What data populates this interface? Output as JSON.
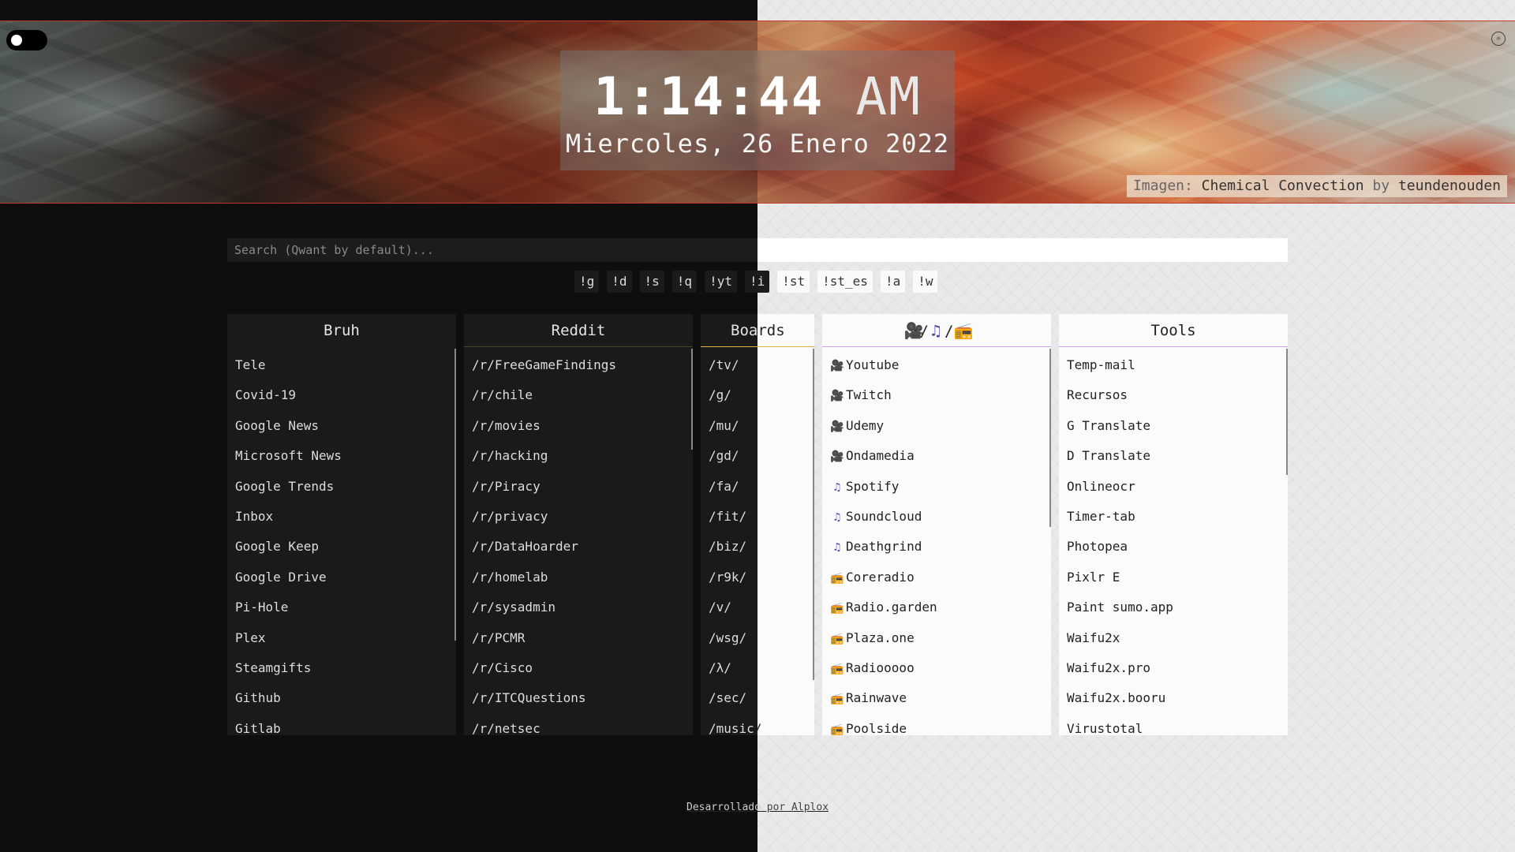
{
  "clock": {
    "time": "1:14:44",
    "ampm": "AM",
    "date": "Miercoles, 26 Enero 2022"
  },
  "credit": {
    "prefix": "Imagen:",
    "title": "Chemical Convection",
    "by": "by",
    "author": "teundenouden"
  },
  "search": {
    "placeholder": "Search (Qwant by default)..."
  },
  "bangs": [
    "!g",
    "!d",
    "!s",
    "!q",
    "!yt",
    "!i",
    "!st",
    "!st_es",
    "!a",
    "!w"
  ],
  "columns": {
    "bruh": {
      "title": "Bruh",
      "items": [
        "Tele",
        "Covid-19",
        "Google News",
        "Microsoft News",
        "Google Trends",
        "Inbox",
        "Google Keep",
        "Google Drive",
        "Pi-Hole",
        "Plex",
        "Steamgifts",
        "Github",
        "Gitlab"
      ]
    },
    "reddit": {
      "title": "Reddit",
      "items": [
        "/r/FreeGameFindings",
        "/r/chile",
        "/r/movies",
        "/r/hacking",
        "/r/Piracy",
        "/r/privacy",
        "/r/DataHoarder",
        "/r/homelab",
        "/r/sysadmin",
        "/r/PCMR",
        "/r/Cisco",
        "/r/ITCQuestions",
        "/r/netsec"
      ]
    },
    "boards": {
      "title_left": "Boa",
      "title_right": "rds",
      "items": [
        {
          "l": "/tv/",
          "r": ""
        },
        {
          "l": "/g/",
          "r": ""
        },
        {
          "l": "/mu/",
          "r": ""
        },
        {
          "l": "/gd/",
          "r": ""
        },
        {
          "l": "/fa/",
          "r": ""
        },
        {
          "l": "/fit/",
          "r": ""
        },
        {
          "l": "/biz/",
          "r": ""
        },
        {
          "l": "/r9k/",
          "r": ""
        },
        {
          "l": "/v/",
          "r": ""
        },
        {
          "l": "/wsg/",
          "r": ""
        },
        {
          "l": "/λ/",
          "r": ""
        },
        {
          "l": "/sec/",
          "r": ""
        },
        {
          "l": "/music",
          "r": "/"
        }
      ]
    },
    "media": {
      "title_sep": "/",
      "items": [
        {
          "icon": "video-camera-icon",
          "glyph": "🎥",
          "label": "Youtube"
        },
        {
          "icon": "video-camera-icon",
          "glyph": "🎥",
          "label": "Twitch"
        },
        {
          "icon": "video-camera-icon",
          "glyph": "🎥",
          "label": "Udemy"
        },
        {
          "icon": "video-camera-icon",
          "glyph": "🎥",
          "label": "Ondamedia"
        },
        {
          "icon": "music-note-icon",
          "glyph": "♫",
          "label": "Spotify"
        },
        {
          "icon": "music-note-icon",
          "glyph": "♫",
          "label": "Soundcloud"
        },
        {
          "icon": "music-note-icon",
          "glyph": "♫",
          "label": "Deathgrind"
        },
        {
          "icon": "radio-icon",
          "glyph": "📻",
          "label": "Coreradio"
        },
        {
          "icon": "radio-icon",
          "glyph": "📻",
          "label": "Radio.garden"
        },
        {
          "icon": "radio-icon",
          "glyph": "📻",
          "label": "Plaza.one"
        },
        {
          "icon": "radio-icon",
          "glyph": "📻",
          "label": "Radiooooo"
        },
        {
          "icon": "radio-icon",
          "glyph": "📻",
          "label": "Rainwave"
        },
        {
          "icon": "radio-icon",
          "glyph": "📻",
          "label": "Poolside"
        }
      ]
    },
    "tools": {
      "title": "Tools",
      "items": [
        "Temp-mail",
        "Recursos",
        "G Translate",
        "D Translate",
        "Onlineocr",
        "Timer-tab",
        "Photopea",
        "Pixlr E",
        "Paint sumo.app",
        "Waifu2x",
        "Waifu2x.pro",
        "Waifu2x.booru",
        "Virustotal"
      ]
    }
  },
  "footer": {
    "left": "Desarrollado",
    "right": " por Alplox"
  },
  "colors": {
    "accent_red": "#c0392b",
    "dark_panel": "#1a1a1a",
    "light_panel": "#fbfbfb",
    "music_icon": "#5a3ea8"
  }
}
